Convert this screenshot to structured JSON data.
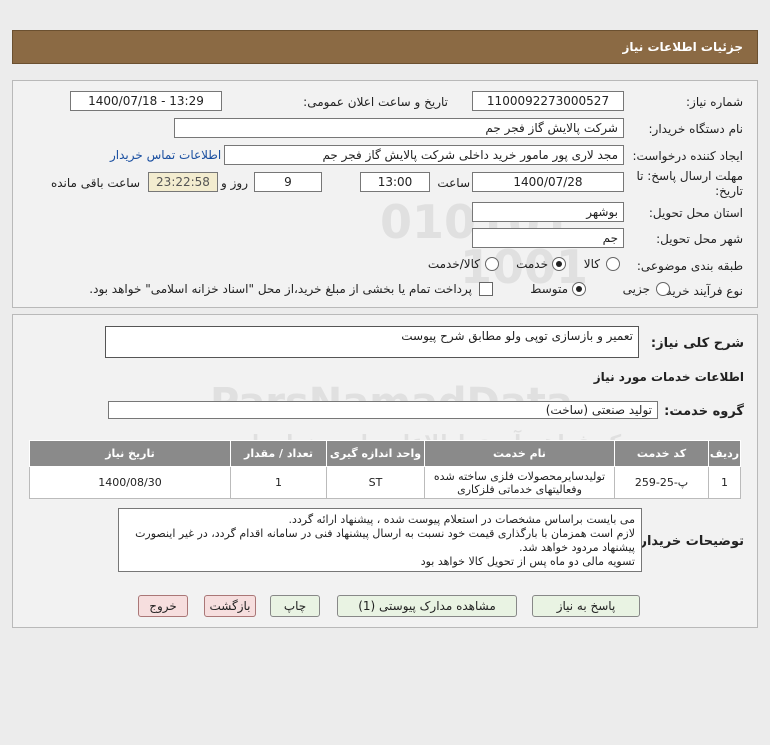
{
  "header": {
    "title": "جزئیات اطلاعات نیاز"
  },
  "form": {
    "need_number_label": "شماره نیاز:",
    "need_number": "1100092273000527",
    "announce_label": "تاریخ و ساعت اعلان عمومی:",
    "announce_value": "1400/07/18 - 13:29",
    "buyer_org_label": "نام دستگاه خریدار:",
    "buyer_org": "شرکت پالایش گاز فجر جم",
    "requester_label": "ایجاد کننده درخواست:",
    "requester": "مجد  لاری پور مامور خرید داخلی شرکت پالایش گاز فجر جم",
    "contact_link": "اطلاعات تماس خریدار",
    "deadline_label_1": "مهلت ارسال پاسخ: تا",
    "deadline_label_2": "تاریخ:",
    "deadline_date": "1400/07/28",
    "time_label": "ساعت",
    "deadline_time": "13:00",
    "days": "9",
    "days_label": "روز و",
    "remaining_time": "23:22:58",
    "remaining_label": "ساعت باقی مانده",
    "province_label": "استان محل تحویل:",
    "province": "بوشهر",
    "city_label": "شهر محل تحویل:",
    "city": "جم",
    "category_label": "طبقه بندی موضوعی:",
    "cat_goods": "کالا",
    "cat_service": "خدمت",
    "cat_goods_service": "کالا/خدمت",
    "purchase_type_label": "نوع فرآیند خرید :",
    "pt_partial": "جزیی",
    "pt_medium": "متوسط",
    "payment_note": "پرداخت تمام یا بخشی از مبلغ خرید،از محل \"اسناد خزانه اسلامی\" خواهد بود."
  },
  "details": {
    "general_desc_label": "شرح کلی نیاز:",
    "general_desc": "تعمیر و بازسازی توپی ولو مطابق شرح پیوست",
    "services_info_title": "اطلاعات خدمات مورد نیاز",
    "service_group_label": "گروه خدمت:",
    "service_group": "تولید صنعتی (ساخت)",
    "table": {
      "headers": [
        "ردیف",
        "کد خدمت",
        "نام خدمت",
        "واحد اندازه گیری",
        "تعداد / مقدار",
        "تاریخ نیاز"
      ],
      "row": [
        "1",
        "پ-25-259",
        "تولیدسایرمحصولات فلزی ساخته شده وفعالیتهای خدماتی فلزکاری",
        "ST",
        "1",
        "1400/08/30"
      ]
    },
    "buyer_notes_label": "توضیحات خریدار:",
    "buyer_notes": [
      "می بایست براساس مشخصات در استعلام پیوست شده ، پیشنهاد ارائه گردد.",
      "لازم است همزمان با بارگذاری قیمت خود نسبت به ارسال پیشنهاد فنی در سامانه اقدام گردد، در غیر اینصورت پیشنهاد مردود خواهد شد.",
      "تسویه مالی دو ماه پس از تحویل کالا خواهد بود"
    ]
  },
  "buttons": {
    "reply": "پاسخ به نیاز",
    "attachments": "مشاهده مدارک پیوستی (1)",
    "print": "چاپ",
    "back": "بازگشت",
    "exit": "خروج"
  },
  "watermark": {
    "line1": "010101",
    "line2": "1001",
    "brand": "ParsNamadData",
    "fa1": "مرکز فراهم آوری اطلاعات پارس نماد داده",
    "fa2": "پایگاه اطلاع رسانی مناقصه و مزایده"
  }
}
